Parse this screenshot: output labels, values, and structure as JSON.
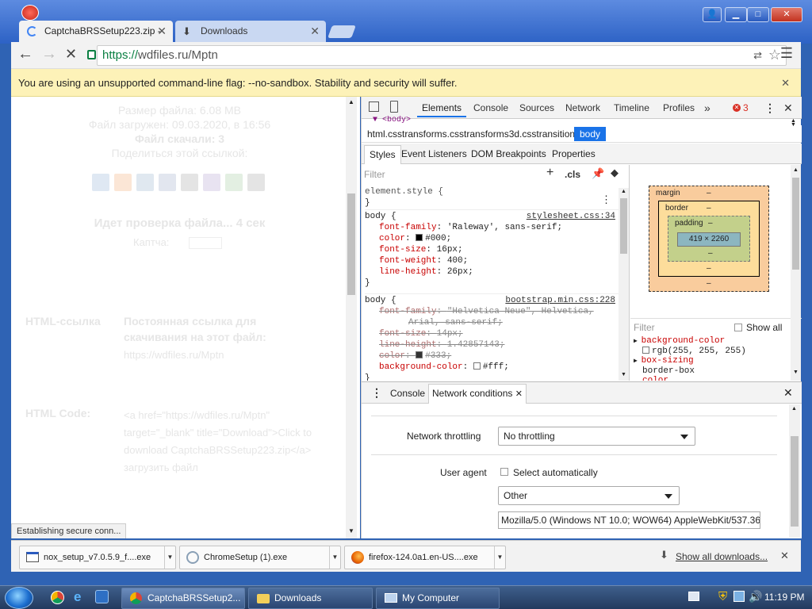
{
  "browser": {
    "tabs": [
      {
        "label": "CaptchaBRSSetup223.zip -"
      },
      {
        "label": "Downloads"
      }
    ],
    "url_scheme": "https://",
    "url_rest": "wdfiles.ru/Mptn",
    "infobar_text": "You are using an unsupported command-line flag: --no-sandbox. Stability and security will suffer.",
    "status_text": "Establishing secure conn..."
  },
  "page": {
    "lines": [
      "Размер файла: 6.08 MB",
      "Файл загружен: 09.03.2020, в 16:56",
      "Файл скачали: 3",
      "Поделиться этой ссылкой:"
    ],
    "check_text": "Идет проверка файла... 4 сек",
    "captcha_label": "Каптча:",
    "html_link_label": "HTML-ссылка",
    "permanent_link_text": "Постоянная ссылка для скачивания на этот файл:",
    "permanent_link_url": "https://wdfiles.ru/Mptn",
    "html_code_label": "HTML Code:",
    "html_code_text": "<a href=\"https://wdfiles.ru/Mptn\" target=\"_blank\" title=\"Download\">Click to download CaptchaBRSSetup223.zip</a> загрузить файл"
  },
  "devtools": {
    "tabs": [
      "Elements",
      "Console",
      "Sources",
      "Network",
      "Timeline",
      "Profiles"
    ],
    "error_count": "3",
    "dom_peek": "<body>",
    "breadcrumb": [
      "html.csstransforms.csstransforms3d.csstransitions",
      "body"
    ],
    "subtabs": [
      "Styles",
      "Event Listeners",
      "DOM Breakpoints",
      "Properties"
    ],
    "filter_placeholder": "Filter",
    "cls_label": ".cls",
    "element_style": "element.style {",
    "rules": [
      {
        "selector": "body {",
        "source": "stylesheet.css:34",
        "props": [
          {
            "name": "font-family",
            "value": "'Raleway', sans-serif;"
          },
          {
            "name": "color",
            "value": "#000;",
            "swatch": "#000000"
          },
          {
            "name": "font-size",
            "value": "16px;"
          },
          {
            "name": "font-weight",
            "value": "400;"
          },
          {
            "name": "line-height",
            "value": "26px;"
          }
        ]
      },
      {
        "selector": "body {",
        "source": "bootstrap.min.css:228",
        "props": [
          {
            "name": "font-family",
            "value": "\"Helvetica Neue\", Helvetica,",
            "cont": "Arial, sans-serif;",
            "struck": true
          },
          {
            "name": "font-size",
            "value": "14px;",
            "struck": true
          },
          {
            "name": "line-height",
            "value": "1.42857143;",
            "struck": true
          },
          {
            "name": "color",
            "value": "#333;",
            "swatch": "#333333",
            "struck": true
          },
          {
            "name": "background-color",
            "value": "#fff;",
            "swatch": "#ffffff"
          }
        ]
      }
    ],
    "close_brace": "}",
    "boxmodel": {
      "margin_label": "margin",
      "border_label": "border",
      "padding_label": "padding",
      "content": "419 × 2260",
      "dash": "–"
    },
    "computed_filter_placeholder": "Filter",
    "show_all_label": "Show all",
    "computed": [
      {
        "name": "background-color",
        "value": "rgb(255, 255, 255)"
      },
      {
        "name": "box-sizing",
        "value": "border-box"
      },
      {
        "name": "color",
        "value": ""
      }
    ],
    "drawer": {
      "tabs": [
        "Console",
        "Network conditions"
      ],
      "throttling_label": "Network throttling",
      "throttling_value": "No throttling",
      "useragent_label": "User agent",
      "select_auto_label": "Select automatically",
      "ua_select_value": "Other",
      "ua_string": "Mozilla/5.0 (Windows NT 10.0; WOW64) AppleWebKit/537.36 ("
    }
  },
  "downloads": {
    "items": [
      {
        "label": "nox_setup_v7.0.5.9_f....exe"
      },
      {
        "label": "ChromeSetup (1).exe"
      },
      {
        "label": "firefox-124.0a1.en-US....exe"
      }
    ],
    "show_all": "Show all downloads..."
  },
  "taskbar": {
    "items": [
      {
        "label": "CaptchaBRSSetup2..."
      },
      {
        "label": "Downloads"
      },
      {
        "label": "My Computer"
      }
    ],
    "clock": "11:19 PM"
  },
  "colors": {
    "accent": "#1a73e8",
    "ssl_green": "#0b8043",
    "infobar_bg": "#fdf2b8",
    "error_red": "#d93025",
    "selector_blue": "#1a73e8"
  }
}
